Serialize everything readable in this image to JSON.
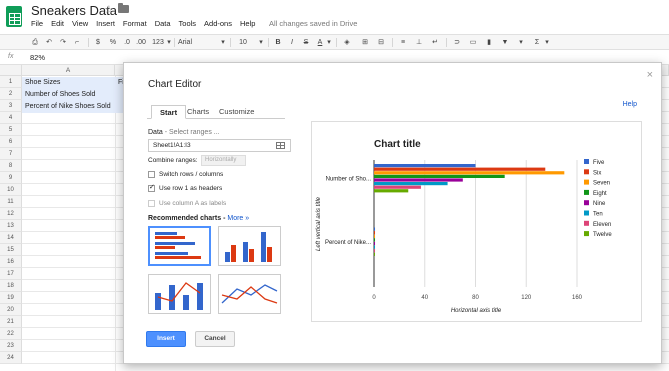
{
  "app": {
    "title": "Sneakers Data",
    "save_status": "All changes saved in Drive",
    "menu": [
      "File",
      "Edit",
      "View",
      "Insert",
      "Format",
      "Data",
      "Tools",
      "Add-ons",
      "Help"
    ]
  },
  "toolbar": {
    "currency": "$",
    "percent": "%",
    "decimal_dec": ".0",
    "decimal_inc": ".00",
    "more_formats": "123",
    "font": "Arial",
    "font_size": "10",
    "bold": "B",
    "italic": "I",
    "strike": "S",
    "text_color": "A"
  },
  "formula_bar": {
    "fx": "fx",
    "value": "82%"
  },
  "sheet": {
    "column_header": "A",
    "row_numbers": [
      "1",
      "2",
      "3",
      "4",
      "5",
      "6",
      "7",
      "8",
      "9",
      "10",
      "11",
      "12",
      "13",
      "14",
      "15",
      "16",
      "17",
      "18",
      "19",
      "20",
      "21",
      "22",
      "23",
      "24"
    ],
    "cells": [
      "Shoe Sizes",
      "Number of Shoes Sold",
      "Percent of Nike Shoes Sold"
    ],
    "partial_cell": "Fi"
  },
  "dialog": {
    "title": "Chart Editor",
    "close": "×",
    "help": "Help",
    "tabs": [
      "Start",
      "Charts",
      "Customize"
    ],
    "data_label": "Data",
    "data_hint": " - Select ranges ...",
    "range_value": "Sheet1!A1:I3",
    "combine_label": "Combine ranges:",
    "combine_value": "Horizontally",
    "options": [
      "Switch rows / columns",
      "Use row 1 as headers",
      "Use column A as labels"
    ],
    "recommended_label": "Recommended charts",
    "more_link": "More »",
    "insert": "Insert",
    "cancel": "Cancel"
  },
  "colors": {
    "accent": "#4d90fe",
    "sheets_green": "#0f9d58",
    "series": [
      "#3366cc",
      "#dc3912",
      "#ff9900",
      "#109618",
      "#990099",
      "#0099c6",
      "#dd4477",
      "#66aa00"
    ]
  },
  "chart_data": {
    "type": "bar",
    "orientation": "horizontal",
    "title": "Chart title",
    "xlabel": "Horizontal axis title",
    "ylabel": "Left vertical axis title",
    "categories": [
      "Number of Sho...",
      "Percent of Nike..."
    ],
    "xlim": [
      0,
      160
    ],
    "xticks": [
      "0",
      "40",
      "80",
      "120",
      "160"
    ],
    "legend_position": "right",
    "gridlines": true,
    "series": [
      {
        "name": "Five",
        "values": [
          80,
          0.8
        ]
      },
      {
        "name": "Six",
        "values": [
          135,
          0.8
        ]
      },
      {
        "name": "Seven",
        "values": [
          150,
          0.8
        ]
      },
      {
        "name": "Eight",
        "values": [
          103,
          0.8
        ]
      },
      {
        "name": "Nine",
        "values": [
          70,
          0.8
        ]
      },
      {
        "name": "Ten",
        "values": [
          58,
          0.8
        ]
      },
      {
        "name": "Eleven",
        "values": [
          37,
          0.8
        ]
      },
      {
        "name": "Twelve",
        "values": [
          27,
          0.8
        ]
      }
    ]
  }
}
